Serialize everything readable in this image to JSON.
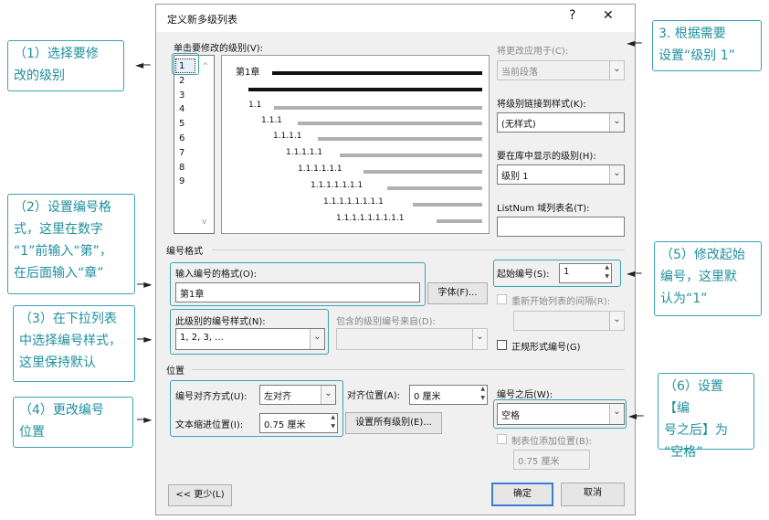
{
  "dialog": {
    "title": "定义新多级列表",
    "help": "?",
    "close": "✕"
  },
  "level_pane": {
    "label": "单击要修改的级别(V):",
    "levels": [
      "1",
      "2",
      "3",
      "4",
      "5",
      "6",
      "7",
      "8",
      "9"
    ],
    "selected": "1"
  },
  "preview": {
    "first": "第1章",
    "items": [
      "1.1",
      "1.1.1",
      "1.1.1.1",
      "1.1.1.1.1",
      "1.1.1.1.1.1",
      "1.1.1.1.1.1.1",
      "1.1.1.1.1.1.1.1",
      "1.1.1.1.1.1.1.1.1"
    ]
  },
  "right_panel": {
    "apply_label": "将更改应用于(C):",
    "apply_value": "当前段落",
    "link_label": "将级别链接到样式(K):",
    "link_value": "(无样式)",
    "gallery_label": "要在库中显示的级别(H):",
    "gallery_value": "级别 1",
    "listnum_label": "ListNum 域列表名(T):",
    "listnum_value": ""
  },
  "number_format": {
    "section": "编号格式",
    "format_label": "输入编号的格式(O):",
    "format_value": "第1章",
    "font_button": "字体(F)...",
    "style_label": "此级别的编号样式(N):",
    "style_value": "1, 2, 3, ...",
    "include_label": "包含的级别编号来自(D):",
    "start_label": "起始编号(S):",
    "start_value": "1",
    "restart_label": "重新开始列表的间隔(R):",
    "legal_label": "正规形式编号(G)"
  },
  "position": {
    "section": "位置",
    "align_label": "编号对齐方式(U):",
    "align_value": "左对齐",
    "align_at_label": "对齐位置(A):",
    "align_at_value": "0 厘米",
    "indent_label": "文本缩进位置(I):",
    "indent_value": "0.75 厘米",
    "set_all_button": "设置所有级别(E)...",
    "follow_label": "编号之后(W):",
    "follow_value": "空格",
    "tab_label": "制表位添加位置(B):",
    "tab_value": "0.75 厘米"
  },
  "buttons": {
    "less": "<< 更少(L)",
    "ok": "确定",
    "cancel": "取消"
  },
  "callouts": {
    "c1": [
      "（1）选择要修",
      "改的级别"
    ],
    "c2": [
      "（2）设置编号格",
      "式，这里在数字",
      "“1”前输入“第”，",
      "在后面输入“章”"
    ],
    "c3": [
      "（3）在下拉列表",
      "中选择编号样式，",
      "这里保持默认"
    ],
    "c4": [
      "（4）更改编号",
      "位置"
    ],
    "c5": [
      "（5）修改起始",
      "编号，这里默",
      "认为“1”"
    ],
    "c6": [
      "（6）设置【编",
      "号之后】为",
      "“空格”"
    ],
    "c7": [
      "3. 根据需要",
      "设置“级别 1”"
    ]
  },
  "colors": {
    "accent": "#3aa3b4",
    "callout_text": "#20909e"
  }
}
